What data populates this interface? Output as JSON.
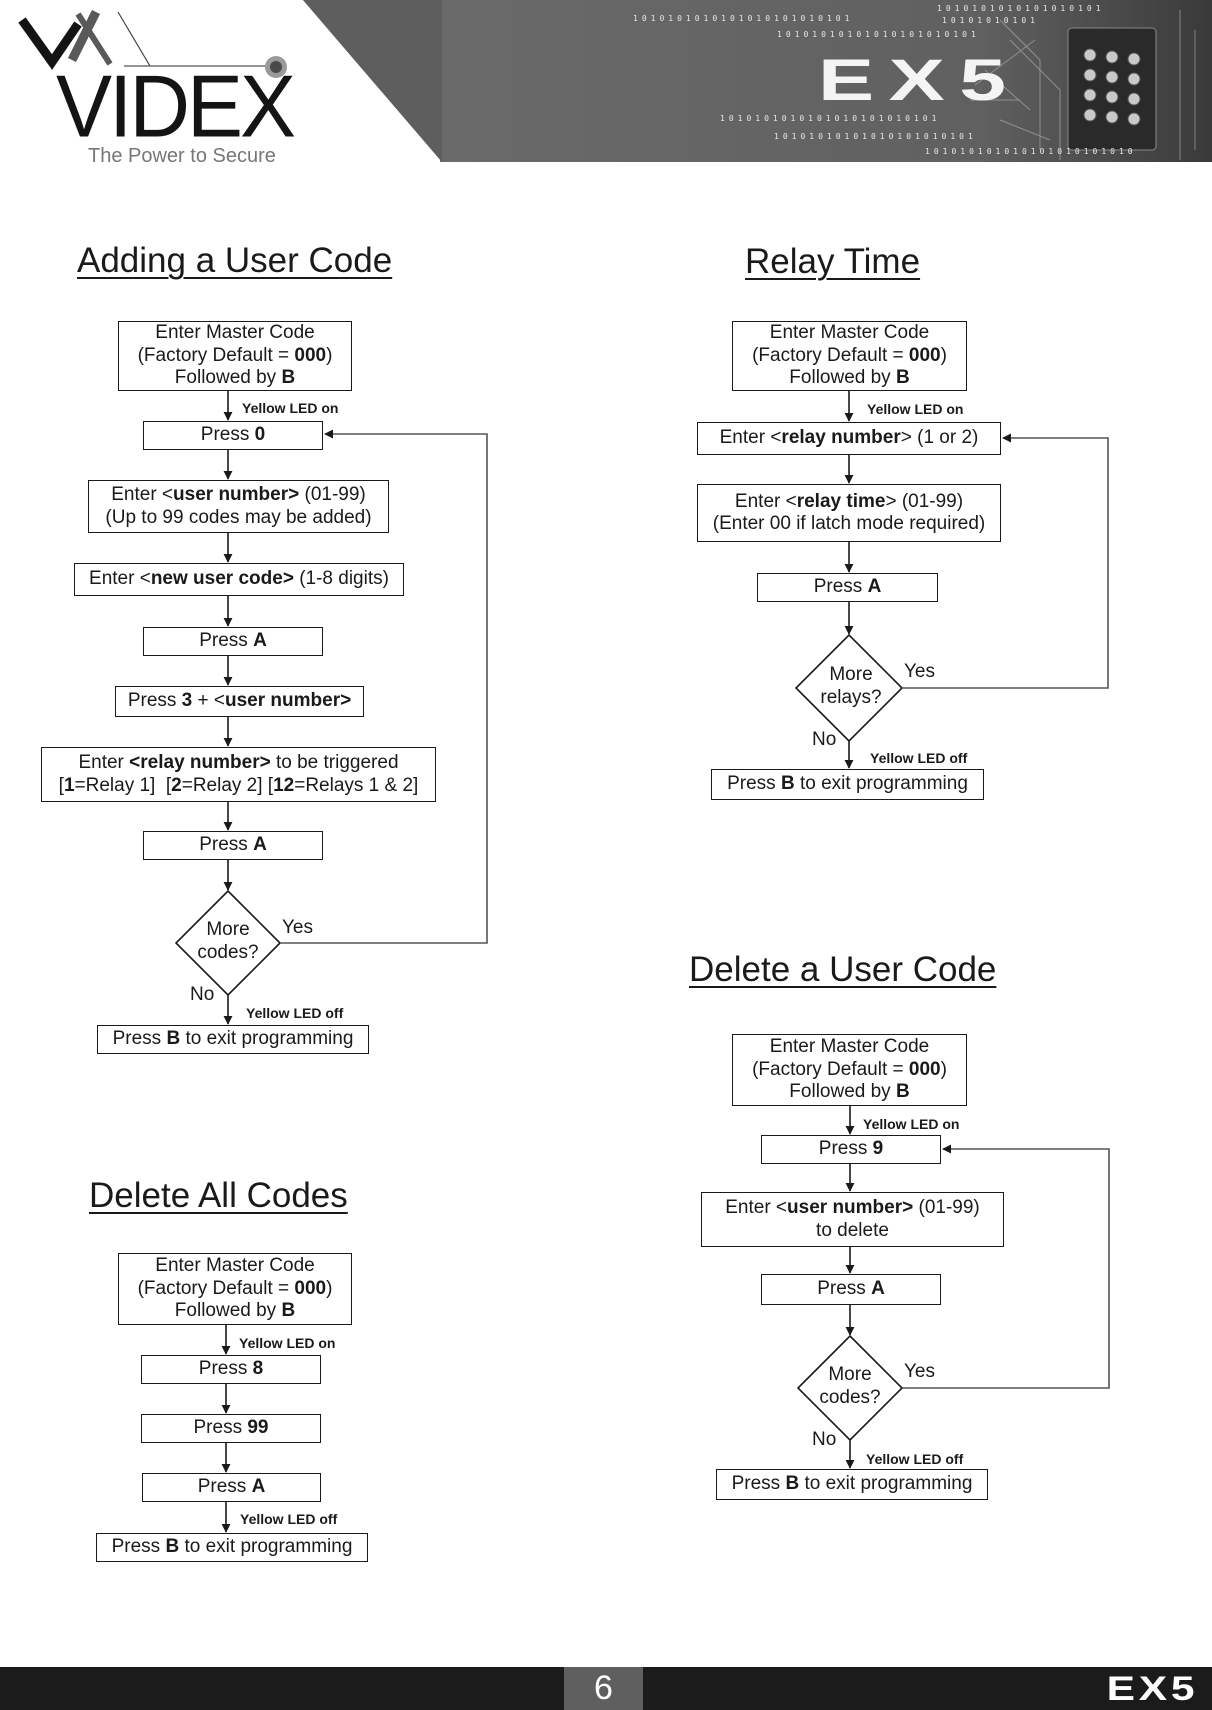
{
  "header": {
    "logo": {
      "mark": "VX",
      "brand": "VIDEX",
      "tagline": "The Power to Secure"
    },
    "product_banner": "EX5",
    "binary_strings": [
      "1010101010101010101",
      "1010101010101010101010101",
      "10101010101",
      "10101010101010101010101",
      "1010101010101010101010101",
      "10101010101010101010101",
      "101010101010101010101010"
    ]
  },
  "sections": {
    "adding_user_code": {
      "title": "Adding a User Code",
      "steps": {
        "master": {
          "l1": "Enter Master Code",
          "l2a": "(Factory Default = ",
          "l2b": "000",
          "l2c": ")",
          "l3a": "Followed by ",
          "l3b": "B"
        },
        "led_on": "Yellow LED on",
        "press0": {
          "a": "Press ",
          "b": "0"
        },
        "user_number": {
          "a": "Enter <",
          "b": "user number>",
          "c": " (01-99)",
          "l2": "(Up to 99 codes may be added)"
        },
        "new_code": {
          "a": "Enter <",
          "b": "new user code>",
          "c": " (1-8 digits)"
        },
        "pressA1": {
          "a": "Press ",
          "b": "A"
        },
        "press3": {
          "a": "Press ",
          "b": "3",
          "c": " + <",
          "d": "user number>"
        },
        "relay": {
          "a": "Enter ",
          "b": "<relay number>",
          "c": " to be triggered",
          "l2a": "[",
          "l2b": "1",
          "l2c": "=Relay 1]  [",
          "l2d": "2",
          "l2e": "=Relay 2] [",
          "l2f": "12",
          "l2g": "=Relays 1 & 2]"
        },
        "pressA2": {
          "a": "Press ",
          "b": "A"
        },
        "decision": {
          "l1": "More",
          "l2": "codes?",
          "yes": "Yes",
          "no": "No"
        },
        "led_off": "Yellow LED off",
        "exit": {
          "a": "Press ",
          "b": "B",
          "c": " to exit programming"
        }
      }
    },
    "relay_time": {
      "title": "Relay Time",
      "steps": {
        "master": {
          "l1": "Enter Master Code",
          "l2a": "(Factory Default = ",
          "l2b": "000",
          "l2c": ")",
          "l3a": "Followed by ",
          "l3b": "B"
        },
        "led_on": "Yellow LED on",
        "relay_number": {
          "a": "Enter <",
          "b": "relay number",
          "c": "> (1 or 2)"
        },
        "relay_time": {
          "a": "Enter <",
          "b": "relay time",
          "c": "> (01-99)",
          "l2": "(Enter 00 if latch mode required)"
        },
        "pressA": {
          "a": "Press ",
          "b": "A"
        },
        "decision": {
          "l1": "More",
          "l2": "relays?",
          "yes": "Yes",
          "no": "No"
        },
        "led_off": "Yellow LED off",
        "exit": {
          "a": "Press ",
          "b": "B",
          "c": " to exit programming"
        }
      }
    },
    "delete_user_code": {
      "title": "Delete a User Code",
      "steps": {
        "master": {
          "l1": "Enter Master Code",
          "l2a": "(Factory Default = ",
          "l2b": "000",
          "l2c": ")",
          "l3a": "Followed by ",
          "l3b": "B"
        },
        "led_on": "Yellow LED on",
        "press9": {
          "a": "Press ",
          "b": "9"
        },
        "user_number": {
          "a": "Enter <",
          "b": "user number>",
          "c": " (01-99)",
          "l2": "to delete"
        },
        "pressA": {
          "a": "Press ",
          "b": "A"
        },
        "decision": {
          "l1": "More",
          "l2": "codes?",
          "yes": "Yes",
          "no": "No"
        },
        "led_off": "Yellow LED off",
        "exit": {
          "a": "Press ",
          "b": "B",
          "c": " to exit programming"
        }
      }
    },
    "delete_all_codes": {
      "title": "Delete All Codes",
      "steps": {
        "master": {
          "l1": "Enter Master Code",
          "l2a": "(Factory Default = ",
          "l2b": "000",
          "l2c": ")",
          "l3a": "Followed by ",
          "l3b": "B"
        },
        "led_on": "Yellow LED on",
        "press8": {
          "a": "Press ",
          "b": "8"
        },
        "press99": {
          "a": "Press ",
          "b": "99"
        },
        "pressA": {
          "a": "Press ",
          "b": "A"
        },
        "led_off": "Yellow LED off",
        "exit": {
          "a": "Press ",
          "b": "B",
          "c": " to exit programming"
        }
      }
    }
  },
  "footer": {
    "page_number": "6",
    "brand": "EX5"
  },
  "colors": {
    "header_band": "#666666",
    "footer_bar": "#1b1b1b",
    "page_box": "#5f5f5f",
    "ink": "#1a1a1a"
  }
}
